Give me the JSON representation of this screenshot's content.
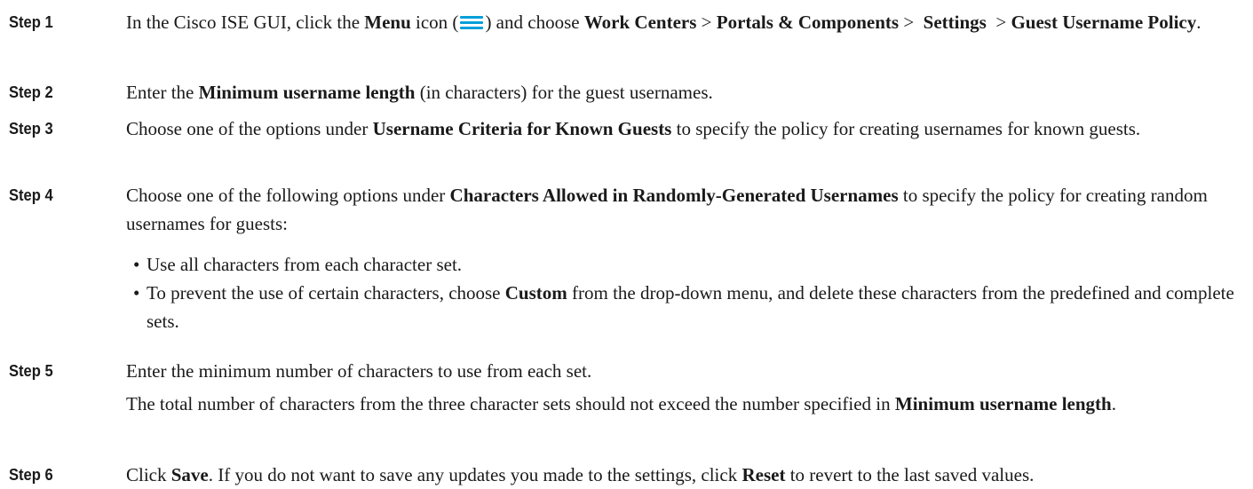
{
  "steps": [
    {
      "label": "Step 1",
      "t1": "In the Cisco ISE GUI, click the ",
      "b1": "Menu",
      "t2": " icon (",
      "icon": "menu-icon",
      "t3": ") and choose ",
      "b2": "Work Centers",
      "t4": " > ",
      "b3": "Portals & Components",
      "t5": " >  ",
      "b4": "Settings",
      "t6": "  > ",
      "b5": "Guest Username Policy",
      "t7": "."
    },
    {
      "label": "Step 2",
      "t1": "Enter the ",
      "b1": "Minimum username length",
      "t2": " (in characters) for the guest usernames."
    },
    {
      "label": "Step 3",
      "t1": "Choose one of the options under ",
      "b1": "Username Criteria for Known Guests",
      "t2": " to specify the policy for creating usernames for known guests."
    },
    {
      "label": "Step 4",
      "t1": "Choose one of the following options under ",
      "b1": "Characters Allowed in Randomly-Generated Usernames",
      "t2": " to specify the policy for creating random usernames for guests:",
      "bullet1": "Use all characters from each character set.",
      "bullet2_a": "To prevent the use of certain characters, choose ",
      "bullet2_b": "Custom",
      "bullet2_c": " from the drop-down menu, and delete these characters from the predefined and complete sets."
    },
    {
      "label": "Step 5",
      "t1": "Enter the minimum number of characters to use from each set.",
      "n1": "The total number of characters from the three character sets should not exceed the number specified in ",
      "nb": "Minimum username length",
      "n2": "."
    },
    {
      "label": "Step 6",
      "t1": "Click ",
      "b1": "Save",
      "t2": ". If you do not want to save any updates you made to the settings, click ",
      "b2": "Reset",
      "t3": " to revert to the last saved values."
    }
  ]
}
